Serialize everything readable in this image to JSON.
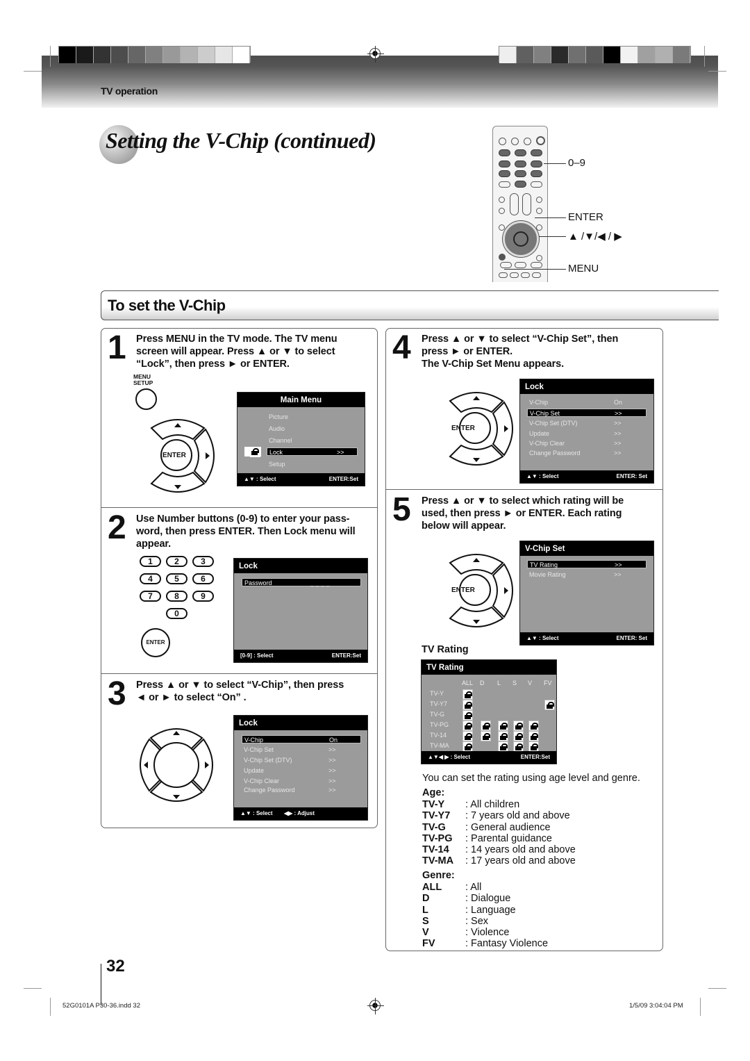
{
  "header": {
    "section_label": "TV operation",
    "swatches_left": [
      "#000000",
      "#1a1a1a",
      "#333333",
      "#4d4d4d",
      "#666666",
      "#808080",
      "#999999",
      "#b3b3b3",
      "#cccccc",
      "#e6e6e6",
      "#ffffff"
    ],
    "swatches_right": [
      "#eeeeee",
      "#606060",
      "#808080",
      "#2a2a2a",
      "#707070",
      "#5a5a5a",
      "#000000",
      "#f2f2f2",
      "#a0a0a0",
      "#b0b0b0",
      "#7a7a7a"
    ]
  },
  "title": "Setting the V-Chip (continued)",
  "remote": {
    "labels": {
      "digits": "0–9",
      "enter": "ENTER",
      "arrows": "▲ /▼/◀ / ▶",
      "menu": "MENU"
    }
  },
  "section": {
    "title": "To set the V-Chip"
  },
  "steps": [
    {
      "number": "1",
      "lines": [
        "Press MENU in the TV mode. The TV menu",
        "screen will appear. Press ▲ or ▼ to select",
        "“Lock”, then press ► or ENTER."
      ],
      "button_label": [
        "MENU",
        "SETUP"
      ],
      "enter_label": "ENTER",
      "screen": {
        "title": "Main Menu",
        "items": [
          {
            "label": "Picture",
            "value": ""
          },
          {
            "label": "Audio",
            "value": ""
          },
          {
            "label": "Channel",
            "value": ""
          },
          {
            "label": "Lock",
            "value": ">>",
            "selected": true
          },
          {
            "label": "Setup",
            "value": ""
          }
        ],
        "footer_left": "▲▼ : Select",
        "footer_right": "ENTER:Set"
      }
    },
    {
      "number": "2",
      "lines": [
        "Use Number buttons (0-9) to enter your pass-",
        "word, then press ENTER. Then Lock menu will",
        "appear."
      ],
      "keys": [
        "1",
        "2",
        "3",
        "4",
        "5",
        "6",
        "7",
        "8",
        "9",
        "0"
      ],
      "enter_label": "ENTER",
      "screen": {
        "title": "Lock",
        "items": [
          {
            "label": "Password",
            "value": "_ _ _ _",
            "selected": true
          }
        ],
        "footer_left": "[0-9] : Select",
        "footer_right": "ENTER:Set"
      }
    },
    {
      "number": "3",
      "lines": [
        "Press ▲ or ▼ to select “V-Chip”, then press",
        "◄ or ► to select “On” ."
      ],
      "screen": {
        "title": "Lock",
        "items": [
          {
            "label": "V-Chip",
            "value": "On",
            "selected": true
          },
          {
            "label": "V-Chip Set",
            "value": ">>"
          },
          {
            "label": "V-Chip Set (DTV)",
            "value": ">>"
          },
          {
            "label": "Update",
            "value": ">>"
          },
          {
            "label": "V-Chip Clear",
            "value": ">>"
          },
          {
            "label": "Change Password",
            "value": ">>"
          }
        ],
        "footer_left": "▲▼ : Select",
        "footer_mid": "◀▶ : Adjust"
      }
    },
    {
      "number": "4",
      "lines": [
        "Press ▲ or ▼ to select “V-Chip Set”, then",
        "press ► or ENTER.",
        "The V-Chip Set Menu appears."
      ],
      "enter_label": "ENTER",
      "screen": {
        "title": "Lock",
        "items": [
          {
            "label": "V-Chip",
            "value": "On"
          },
          {
            "label": "V-Chip Set",
            "value": ">>",
            "selected": true
          },
          {
            "label": "V-Chip Set (DTV)",
            "value": ">>"
          },
          {
            "label": "Update",
            "value": ">>"
          },
          {
            "label": "V-Chip Clear",
            "value": ">>"
          },
          {
            "label": "Change Password",
            "value": ">>"
          }
        ],
        "footer_left": "▲▼ : Select",
        "footer_right": "ENTER: Set"
      }
    },
    {
      "number": "5",
      "lines": [
        "Press ▲ or ▼ to select which rating will be",
        "used, then press ► or ENTER. Each rating",
        "below will appear."
      ],
      "enter_label": "ENTER",
      "screen": {
        "title": "V-Chip Set",
        "items": [
          {
            "label": "TV Rating",
            "value": ">>",
            "selected": true
          },
          {
            "label": "Movie Rating",
            "value": ">>"
          }
        ],
        "footer_left": "▲▼ : Select",
        "footer_right": "ENTER: Set"
      },
      "subheading": "TV Rating",
      "rating_screen": {
        "title": "TV Rating",
        "columns": [
          "ALL",
          "D",
          "L",
          "S",
          "V",
          "FV"
        ],
        "rows": [
          {
            "label": "TV-Y",
            "locks": [
              true,
              false,
              false,
              false,
              false,
              false
            ]
          },
          {
            "label": "TV-Y7",
            "locks": [
              true,
              false,
              false,
              false,
              false,
              true
            ]
          },
          {
            "label": "TV-G",
            "locks": [
              true,
              false,
              false,
              false,
              false,
              false
            ]
          },
          {
            "label": "TV-PG",
            "locks": [
              true,
              true,
              true,
              true,
              true,
              false
            ]
          },
          {
            "label": "TV-14",
            "locks": [
              true,
              true,
              true,
              true,
              true,
              false
            ]
          },
          {
            "label": "TV-MA",
            "locks": [
              true,
              false,
              true,
              true,
              true,
              false
            ]
          }
        ],
        "footer_left": "▲▼◀ ▶  : Select",
        "footer_right": "ENTER:Set"
      },
      "note": "You can set  the rating using age level and genre.",
      "age_heading": "Age:",
      "age": [
        {
          "code": "TV-Y",
          "desc": ": All children"
        },
        {
          "code": "TV-Y7",
          "desc": ": 7 years old and above"
        },
        {
          "code": "TV-G",
          "desc": ": General audience"
        },
        {
          "code": "TV-PG",
          "desc": ": Parental guidance"
        },
        {
          "code": "TV-14",
          "desc": ": 14 years old and above"
        },
        {
          "code": "TV-MA",
          "desc": ": 17 years old and above"
        }
      ],
      "genre_heading": "Genre:",
      "genre": [
        {
          "code": "ALL",
          "desc": ": All"
        },
        {
          "code": "D",
          "desc": ": Dialogue"
        },
        {
          "code": "L",
          "desc": ": Language"
        },
        {
          "code": "S",
          "desc": ": Sex"
        },
        {
          "code": "V",
          "desc": ": Violence"
        },
        {
          "code": "FV",
          "desc": ": Fantasy Violence"
        }
      ]
    }
  ],
  "footer": {
    "page_number": "32",
    "file": "52G0101A P30-36.indd   32",
    "timestamp": "1/5/09   3:04:04 PM"
  }
}
